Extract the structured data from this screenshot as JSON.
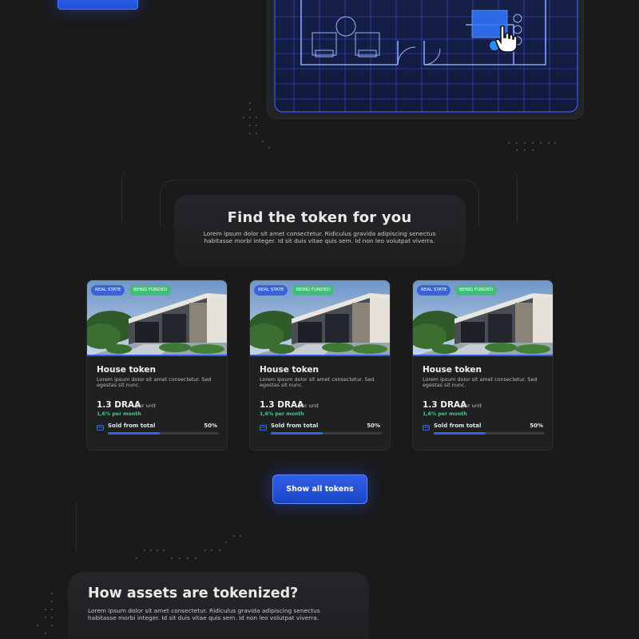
{
  "colors": {
    "background": "#1a1a1b",
    "accent": "#2f63f0",
    "success": "#3fce7b"
  },
  "find_section": {
    "title": "Find the token for you",
    "description": "Lorem ipsum dolor sit amet consectetur. Ridiculus gravida adipiscing senectus habitasse morbi integer. Id sit duis vitae quis sem. Id non leo volutpat viverra."
  },
  "cards": [
    {
      "badge_category": "REAL STATE",
      "badge_status": "BEING FUNDED",
      "title": "House token",
      "description": "Lorem ipsum dolor sit amet consectetur. Sed egestas sit nunc.",
      "price": "1.3 DRAA",
      "price_unit": "per unit",
      "yield": "1,6% per month",
      "sold_label": "Sold from total",
      "sold_percent_text": "50%",
      "sold_fraction": 0.47
    },
    {
      "badge_category": "REAL STATE",
      "badge_status": "BEING FUNDED",
      "title": "House token",
      "description": "Lorem ipsum dolor sit amet consectetur. Sed egestas sit nunc.",
      "price": "1.3 DRAA",
      "price_unit": "per unit",
      "yield": "1,6% per month",
      "sold_label": "Sold from total",
      "sold_percent_text": "50%",
      "sold_fraction": 0.47
    },
    {
      "badge_category": "REAL STATE",
      "badge_status": "BEING FUNDED",
      "title": "House token",
      "description": "Lorem ipsum dolor sit amet consectetur. Sed egestas sit nunc.",
      "price": "1.3 DRAA",
      "price_unit": "per unit",
      "yield": "1,6% per month",
      "sold_label": "Sold from total",
      "sold_percent_text": "50%",
      "sold_fraction": 0.47
    }
  ],
  "show_all_button": "Show all tokens",
  "how_section": {
    "title": "How assets are tokenized?",
    "description": "Lorem ipsum dolor sit amet consectetur. Ridiculus gravida adipiscing senectus habitasse morbi integer. Id sit duis vitae quis sem. Id non leo volutpat viverra."
  },
  "icons": {
    "floor_plan": "floor-plan-illustration",
    "cursor": "hand-cursor-icon",
    "sold": "wallet-icon"
  }
}
